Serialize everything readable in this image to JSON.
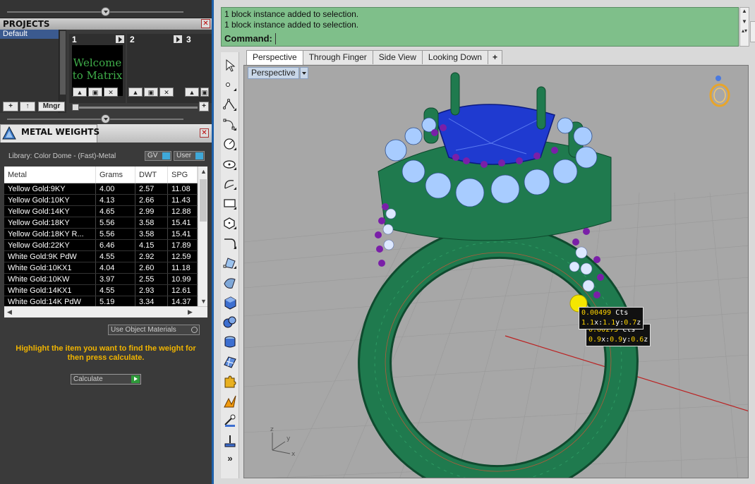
{
  "projects_panel": {
    "title": "PROJECTS",
    "list": [
      "Default"
    ],
    "slots": [
      {
        "num": "1",
        "thumb": "Welcome to Matrix"
      },
      {
        "num": "2",
        "thumb": ""
      },
      {
        "num": "3",
        "thumb": ""
      }
    ],
    "footer": {
      "add": "+",
      "up": "↑",
      "mngr": "Mngr",
      "plus": "+"
    }
  },
  "metal_panel": {
    "title": "METAL WEIGHTS",
    "library": "Library: Color Dome - (Fast)-Metal",
    "toggle_gv": "GV",
    "toggle_user": "User",
    "columns": [
      "Metal",
      "Grams",
      "DWT",
      "SPG"
    ],
    "rows": [
      [
        "Yellow Gold:9KY",
        "4.00",
        "2.57",
        "11.08"
      ],
      [
        "Yellow Gold:10KY",
        "4.13",
        "2.66",
        "11.43"
      ],
      [
        "Yellow Gold:14KY",
        "4.65",
        "2.99",
        "12.88"
      ],
      [
        "Yellow Gold:18KY",
        "5.56",
        "3.58",
        "15.41"
      ],
      [
        "Yellow Gold:18KY R...",
        "5.56",
        "3.58",
        "15.41"
      ],
      [
        "Yellow Gold:22KY",
        "6.46",
        "4.15",
        "17.89"
      ],
      [
        "White Gold:9K PdW",
        "4.55",
        "2.92",
        "12.59"
      ],
      [
        "White Gold:10KX1",
        "4.04",
        "2.60",
        "11.18"
      ],
      [
        "White Gold:10KW",
        "3.97",
        "2.55",
        "10.99"
      ],
      [
        "White Gold:14KX1",
        "4.55",
        "2.93",
        "12.61"
      ],
      [
        "White Gold:14K PdW",
        "5.19",
        "3.34",
        "14.37"
      ]
    ],
    "use_object_materials": "Use Object Materials",
    "hint": "Highlight the item you want to find the weight for then press calculate.",
    "calculate": "Calculate"
  },
  "command": {
    "history": [
      "1 block instance added to selection.",
      "1 block instance added to selection."
    ],
    "prompt": "Command:",
    "value": ""
  },
  "tabs": [
    "Perspective",
    "Through Finger",
    "Side View",
    "Looking Down",
    "+"
  ],
  "viewport": {
    "label": "Perspective",
    "tooltips": [
      {
        "cts": "0.00499",
        "unit": "Cts",
        "x": "1.1",
        "y": "1.1",
        "z": "0.7"
      },
      {
        "cts": "0.00275",
        "unit": "Cts",
        "x": "0.9",
        "y": "0.9",
        "z": "0.6"
      }
    ],
    "axes": {
      "x": "x",
      "y": "y",
      "z": "z"
    }
  },
  "colors": {
    "metal_green": "#1f7a4e",
    "gem_blue": "#1f3ad0",
    "halo_light_blue": "#a8ccff",
    "accent_purple": "#7a1fa8",
    "command_bg": "#7fbf8a",
    "hint_text": "#f0b400"
  }
}
